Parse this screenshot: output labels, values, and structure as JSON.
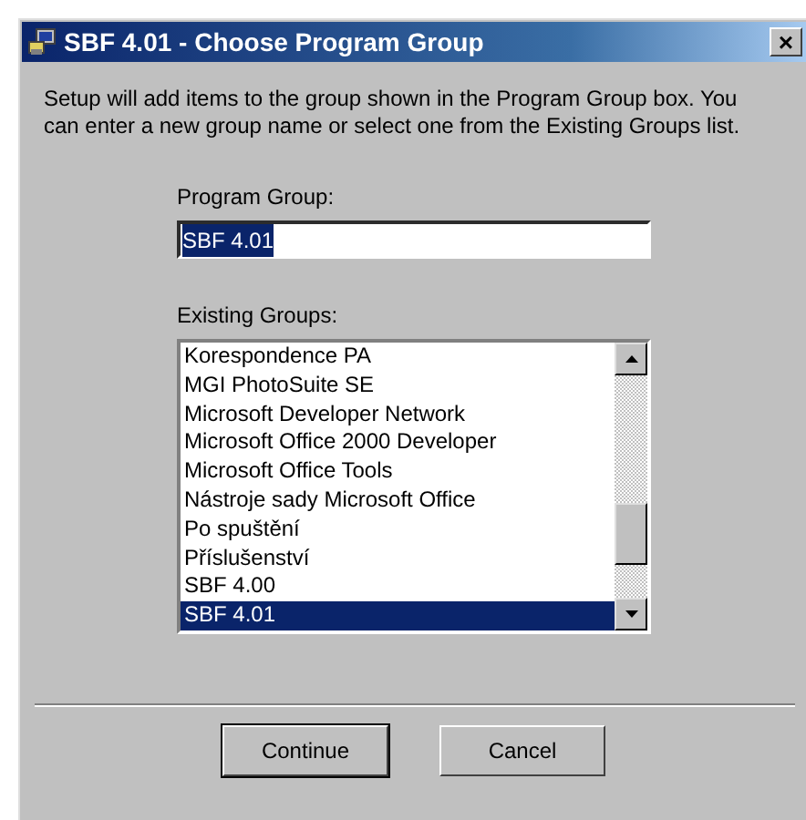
{
  "window": {
    "title": "SBF 4.01 - Choose Program Group",
    "close": "×"
  },
  "intro": "Setup will add items to the group shown in the Program Group box. You can enter a new group name or select one from the Existing Groups list.",
  "program_group": {
    "label": "Program Group:",
    "value": "SBF 4.01",
    "text_selected": true
  },
  "existing_groups": {
    "label": "Existing Groups:",
    "items": [
      {
        "label": "Korespondence PA",
        "selected": false
      },
      {
        "label": "MGI PhotoSuite SE",
        "selected": false
      },
      {
        "label": "Microsoft Developer Network",
        "selected": false
      },
      {
        "label": "Microsoft Office 2000 Developer",
        "selected": false
      },
      {
        "label": "Microsoft Office Tools",
        "selected": false
      },
      {
        "label": "Nástroje sady Microsoft Office",
        "selected": false
      },
      {
        "label": "Po spuštění",
        "selected": false
      },
      {
        "label": "Příslušenství",
        "selected": false
      },
      {
        "label": "SBF 4.00",
        "selected": false
      },
      {
        "label": "SBF 4.01",
        "selected": true
      }
    ]
  },
  "buttons": [
    {
      "label": "Continue",
      "default": true
    },
    {
      "label": "Cancel",
      "default": false
    }
  ]
}
